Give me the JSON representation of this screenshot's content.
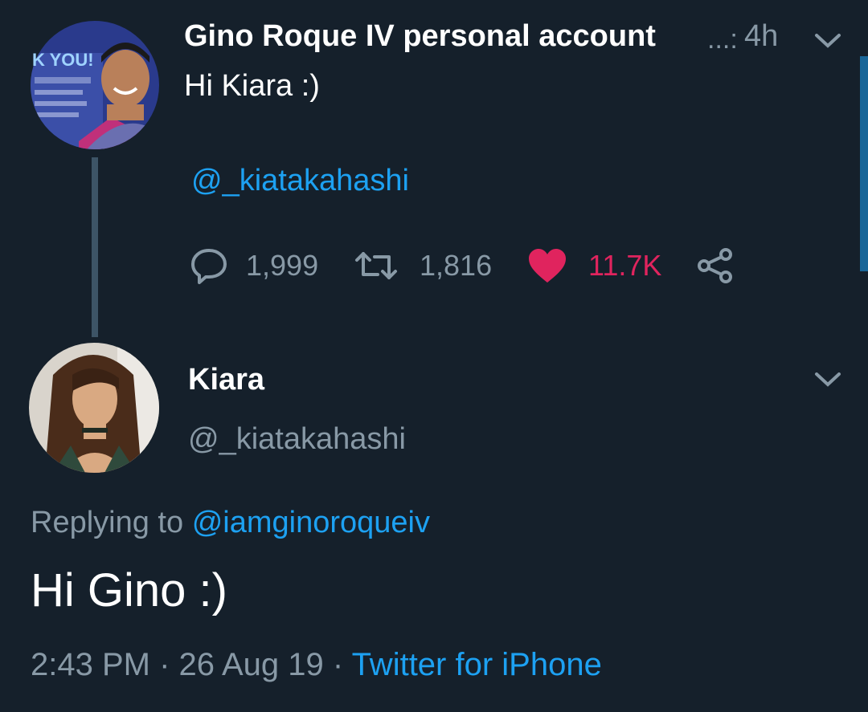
{
  "parent_tweet": {
    "display_name": "Gino Roque IV personal account",
    "truncation_mark": "...:",
    "time": "4h",
    "text": "Hi Kiara :)",
    "mention": "@_kiatakahashi",
    "avatar_banner_text": "K YOU!",
    "reply_count": "1,999",
    "retweet_count": "1,816",
    "like_count": "11.7K"
  },
  "reply_tweet": {
    "display_name": "Kiara",
    "handle": "@_kiatakahashi",
    "replying_prefix": "Replying to",
    "replying_to": "@iamginoroqueiv",
    "text": "Hi Gino :)",
    "time": "2:43 PM",
    "date": "26 Aug 19",
    "source": "Twitter for iPhone",
    "separator": "·"
  },
  "colors": {
    "background": "#15202b",
    "link": "#1da1f2",
    "secondary_text": "#8899a6",
    "like": "#e0245e",
    "thread_line": "#3d5466"
  },
  "icons": [
    "chevron-down-icon",
    "reply-icon",
    "retweet-icon",
    "heart-icon",
    "share-icon"
  ]
}
